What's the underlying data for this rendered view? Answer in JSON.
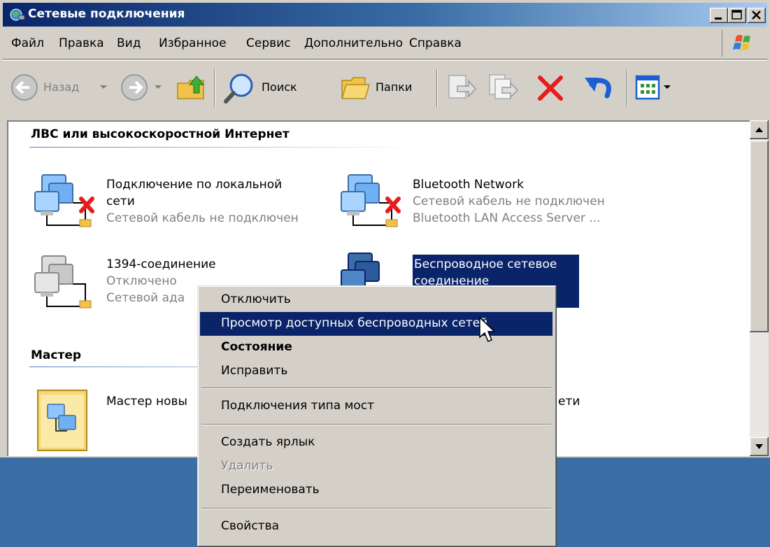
{
  "window": {
    "title": "Сетевые подключения",
    "app_icon": "network-connections-icon"
  },
  "menu": [
    "Файл",
    "Правка",
    "Вид",
    "Избранное",
    "Сервис",
    "Дополнительно",
    "Справка"
  ],
  "toolbar": {
    "back_label": "Назад",
    "search_label": "Поиск",
    "folders_label": "Папки"
  },
  "groups": {
    "lan": {
      "heading": "ЛВС или высокоскоростной Интернет",
      "items": [
        {
          "title1": "Подключение по локальной",
          "title2": "сети",
          "sub1": "Сетевой кабель не подключен"
        },
        {
          "title1": "Bluetooth Network",
          "sub1": "Сетевой кабель не подключен",
          "sub2": "Bluetooth LAN Access Server ..."
        },
        {
          "title1": "1394-соединение",
          "sub1": "Отключено",
          "sub2": "Сетевой ада"
        },
        {
          "title1": "Беспроводное сетевое",
          "title2": "соединение"
        }
      ]
    },
    "wizard": {
      "heading": "Мастер",
      "item_title": "Мастер новы",
      "item_tail": "ети"
    }
  },
  "context_menu": {
    "items": [
      {
        "label": "Отключить",
        "state": "normal"
      },
      {
        "label": "Просмотр доступных беспроводных сетей",
        "state": "highlighted"
      },
      {
        "label": "Состояние",
        "state": "default"
      },
      {
        "label": "Исправить",
        "state": "normal"
      },
      {
        "label": "Подключения типа мост",
        "state": "normal"
      },
      {
        "label": "Создать ярлык",
        "state": "normal"
      },
      {
        "label": "Удалить",
        "state": "disabled"
      },
      {
        "label": "Переименовать",
        "state": "normal"
      },
      {
        "label": "Свойства",
        "state": "normal"
      }
    ]
  },
  "colors": {
    "title_bar": "#0a246a",
    "selection": "#0a246a",
    "desktop": "#3a6ea5",
    "window_face": "#d4d0c8"
  }
}
